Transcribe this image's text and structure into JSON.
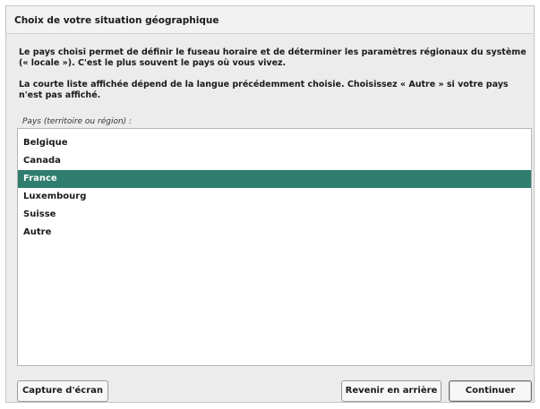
{
  "dialog": {
    "title": "Choix de votre situation géographique",
    "description_1": "Le pays choisi permet de définir le fuseau horaire et de déterminer les paramètres régionaux du système (« locale »). C'est le plus souvent le pays où vous vivez.",
    "description_2": "La courte liste affichée dépend de la langue précédemment choisie. Choisissez « Autre » si votre pays n'est pas affiché.",
    "list_label": "Pays (territoire ou région) :"
  },
  "countries": {
    "items": [
      {
        "label": "Belgique",
        "selected": false
      },
      {
        "label": "Canada",
        "selected": false
      },
      {
        "label": "France",
        "selected": true
      },
      {
        "label": "Luxembourg",
        "selected": false
      },
      {
        "label": "Suisse",
        "selected": false
      },
      {
        "label": "Autre",
        "selected": false
      }
    ],
    "selection_color": "#2f7d6f"
  },
  "buttons": {
    "screenshot": "Capture d'écran",
    "back": "Revenir en arrière",
    "continue": "Continuer"
  }
}
